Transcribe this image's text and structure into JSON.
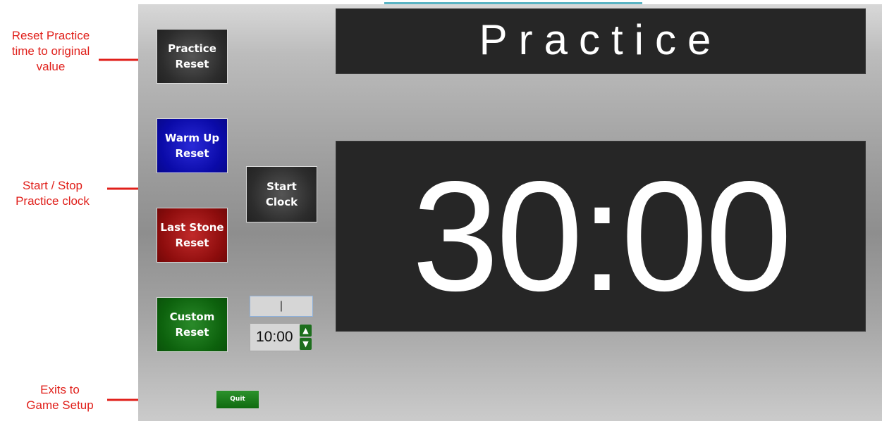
{
  "annotations": {
    "reset_practice": "Reset Practice\ntime to original\nvalue",
    "start_stop": "Start / Stop\nPractice clock",
    "exits": "Exits to\nGame Setup"
  },
  "buttons": {
    "practice_reset": "Practice\nReset",
    "warmup_reset": "Warm Up\nReset",
    "laststone_reset": "Last Stone\nReset",
    "custom_reset": "Custom\nReset",
    "start_clock": "Start\nClock",
    "quit": "Quit"
  },
  "display": {
    "title": "Practice",
    "clock": "30:00"
  },
  "custom": {
    "text_input_value": "|",
    "time_value": "10:00",
    "up_symbol": "▲",
    "down_symbol": "▼"
  },
  "colors": {
    "annotation": "#e0201b",
    "blue_button": "#0a0aa8",
    "red_button": "#8e0d0d",
    "green_button": "#0d620d",
    "dark_button": "#2c2c2c",
    "panel": "#262626"
  }
}
